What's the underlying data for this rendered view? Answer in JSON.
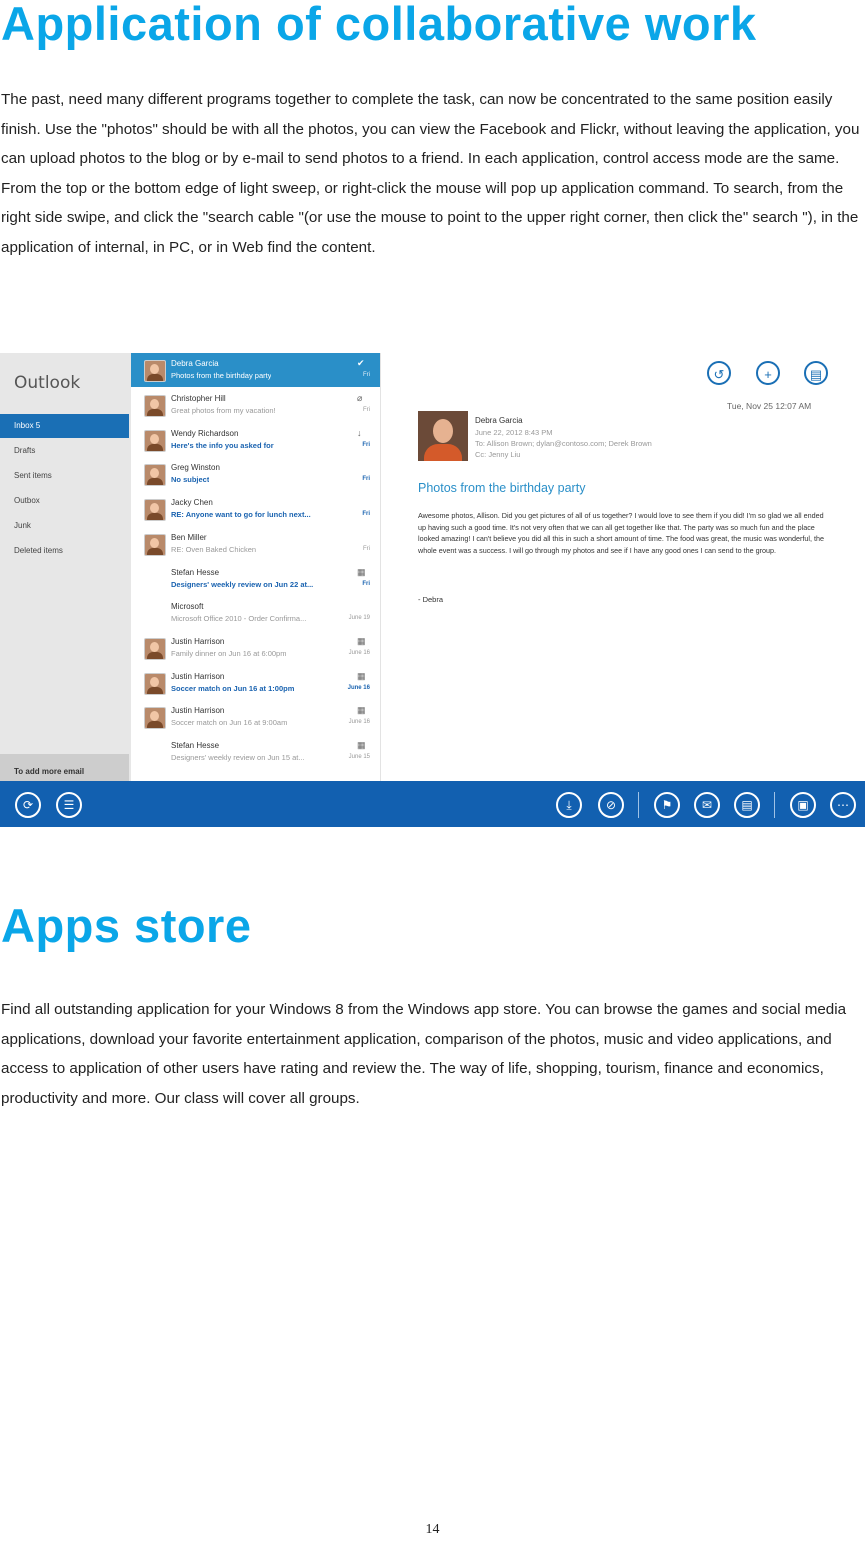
{
  "section1": {
    "title": "Application of collaborative work",
    "paragraph": "The past, need many different programs together to complete the task, can now be concentrated to the same position easily finish. Use the \"photos\" should be with all the photos, you can view the Facebook and Flickr, without leaving the application, you can upload photos to the blog or by e-mail to send photos to a friend. In each application, control access mode are the same. From the top or the bottom edge of light sweep, or right-click the mouse will pop up application command. To search, from the right side swipe, and click the \"search cable \"(or use the mouse to point to the upper right corner, then click the\" search \"), in the application of internal, in PC, or in Web find the content."
  },
  "outlook": {
    "app_title": "Outlook",
    "folders": [
      "Inbox 5",
      "Drafts",
      "Sent items",
      "Outbox",
      "Junk",
      "Deleted items"
    ],
    "add_account": "To add more email",
    "messages": [
      {
        "from": "Debra Garcia",
        "subject": "Photos from the birthday party",
        "date": "Fri",
        "icon": "check-icon",
        "glyph": "✔"
      },
      {
        "from": "Christopher Hill",
        "subject": "Great photos from my vacation!",
        "date": "Fri",
        "icon": "paperclip-icon",
        "glyph": "⌀"
      },
      {
        "from": "Wendy Richardson",
        "subject": "Here's the info you asked for",
        "date": "Fri",
        "icon": "low-importance-icon",
        "glyph": "↓"
      },
      {
        "from": "Greg Winston",
        "subject": "No subject",
        "date": "Fri",
        "icon": "",
        "glyph": ""
      },
      {
        "from": "Jacky Chen",
        "subject": "RE: Anyone want to go for lunch next...",
        "date": "Fri",
        "icon": "",
        "glyph": ""
      },
      {
        "from": "Ben Miller",
        "subject": "RE: Oven Baked Chicken",
        "date": "Fri",
        "icon": "",
        "glyph": ""
      },
      {
        "from": "Stefan Hesse",
        "subject": "Designers' weekly review on Jun 22 at...",
        "date": "Fri",
        "icon": "calendar-icon",
        "glyph": "▦"
      },
      {
        "from": "Microsoft",
        "subject": "Microsoft Office 2010 - Order Confirma...",
        "date": "June 19",
        "icon": "",
        "glyph": ""
      },
      {
        "from": "Justin Harrison",
        "subject": "Family dinner on Jun 16 at 6:00pm",
        "date": "June 16",
        "icon": "calendar-icon",
        "glyph": "▦"
      },
      {
        "from": "Justin Harrison",
        "subject": "Soccer match on Jun 16 at 1:00pm",
        "date": "June 16",
        "icon": "calendar-icon",
        "glyph": "▦"
      },
      {
        "from": "Justin Harrison",
        "subject": "Soccer match on Jun 16 at 9:00am",
        "date": "June 16",
        "icon": "calendar-icon",
        "glyph": "▦"
      },
      {
        "from": "Stefan Hesse",
        "subject": "Designers' weekly review on Jun 15 at...",
        "date": "June 15",
        "icon": "calendar-icon",
        "glyph": "▦"
      }
    ],
    "reading": {
      "datetime": "Tue, Nov 25   12:07 AM",
      "from": "Debra Garcia",
      "sent": "June 22, 2012  8:43 PM",
      "to": "To: Allison Brown; dylan@contoso.com; Derek Brown",
      "cc": "Cc: Jenny Liu",
      "subject": "Photos from the birthday party",
      "body": "Awesome photos, Allison. Did you get pictures of all of us together? I would love to see them if you did! I'm so glad we all ended up having such a good time. It's not very often that we can all get together like that. The party was so much fun and the place looked amazing! I can't believe you did all this in such a short amount of time. The food was great, the music was wonderful, the whole event was a success. I will go through my photos and see if I have any good ones I can send to the group.",
      "signature": "- Debra"
    },
    "accent": "#1260b0"
  },
  "section2": {
    "title": "Apps store",
    "paragraph": "Find all outstanding application for your Windows 8 from the Windows app store. You can browse the games and social media applications, download your favorite entertainment application, comparison of the photos, music and video applications, and access to application of other users have rating and review the. The way of life, shopping, tourism, finance and economics, productivity and more. Our class will cover all groups."
  },
  "page_number": "14"
}
